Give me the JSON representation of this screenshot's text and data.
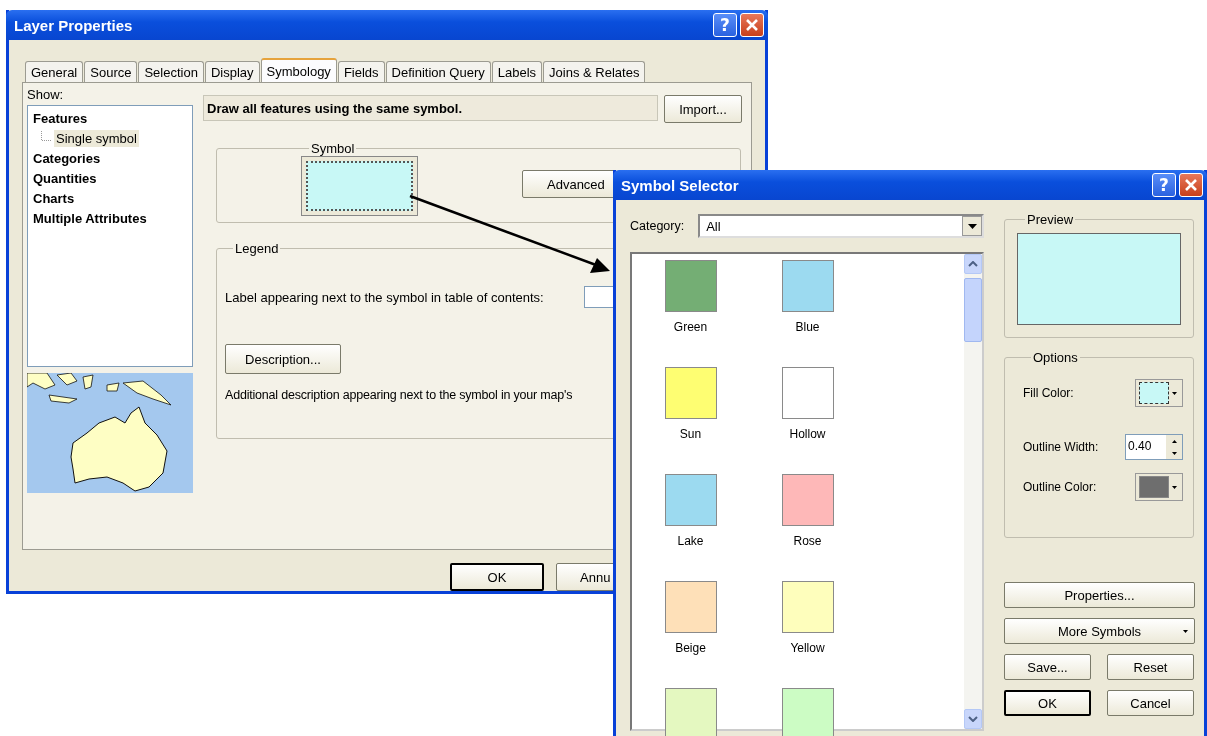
{
  "layer_properties": {
    "title": "Layer Properties",
    "help_button": "?",
    "tabs": [
      {
        "label": "General",
        "selected": false
      },
      {
        "label": "Source",
        "selected": false
      },
      {
        "label": "Selection",
        "selected": false
      },
      {
        "label": "Display",
        "selected": false
      },
      {
        "label": "Symbology",
        "selected": true
      },
      {
        "label": "Fields",
        "selected": false
      },
      {
        "label": "Definition Query",
        "selected": false
      },
      {
        "label": "Labels",
        "selected": false
      },
      {
        "label": "Joins & Relates",
        "selected": false
      }
    ],
    "show_label": "Show:",
    "tree": [
      {
        "label": "Features",
        "selected": false,
        "children": [
          {
            "label": "Single symbol",
            "selected": true
          }
        ]
      },
      {
        "label": "Categories",
        "selected": false
      },
      {
        "label": "Quantities",
        "selected": false
      },
      {
        "label": "Charts",
        "selected": false
      },
      {
        "label": "Multiple Attributes",
        "selected": false
      }
    ],
    "header": "Draw all features using the same symbol.",
    "import_button": "Import...",
    "symbol_group": {
      "title": "Symbol",
      "color": "#c8f8f6",
      "advanced_button": "Advanced"
    },
    "legend_group": {
      "title": "Legend",
      "label_prompt": "Label appearing next to the symbol in table of contents:",
      "description_button": "Description...",
      "description_text": "Additional description appearing next to the symbol in your map's"
    },
    "buttons": [
      "OK",
      "Annu"
    ]
  },
  "symbol_selector": {
    "title": "Symbol Selector",
    "help_button": "?",
    "category_label": "Category:",
    "category_value": "All",
    "symbols": [
      {
        "label": "Green",
        "color": "#74ae74"
      },
      {
        "label": "Blue",
        "color": "#9cdaf0"
      },
      {
        "label": "Sun",
        "color": "#fefe72"
      },
      {
        "label": "Hollow",
        "color": "#ffffff"
      },
      {
        "label": "Lake",
        "color": "#9cdaf0"
      },
      {
        "label": "Rose",
        "color": "#feb8b8"
      },
      {
        "label": "Beige",
        "color": "#fee0b8"
      },
      {
        "label": "Yellow",
        "color": "#fefebc"
      },
      {
        "color": "#e4f8c0"
      },
      {
        "color": "#ccfcc4"
      }
    ],
    "preview": {
      "title": "Preview",
      "color": "#c8f8f6"
    },
    "options": {
      "title": "Options",
      "items": [
        {
          "kind": "color",
          "label": "Fill Color:",
          "color": "#c8f8f6"
        },
        {
          "kind": "spinner",
          "label": "Outline Width:",
          "value": "0.40"
        },
        {
          "kind": "color",
          "label": "Outline Color:",
          "color": "#6e6e6e"
        }
      ]
    },
    "properties_button": "Properties...",
    "more_button": "More Symbols",
    "save_button": "Save...",
    "reset_button": "Reset",
    "ok_button": "OK",
    "cancel_button": "Cancel"
  }
}
